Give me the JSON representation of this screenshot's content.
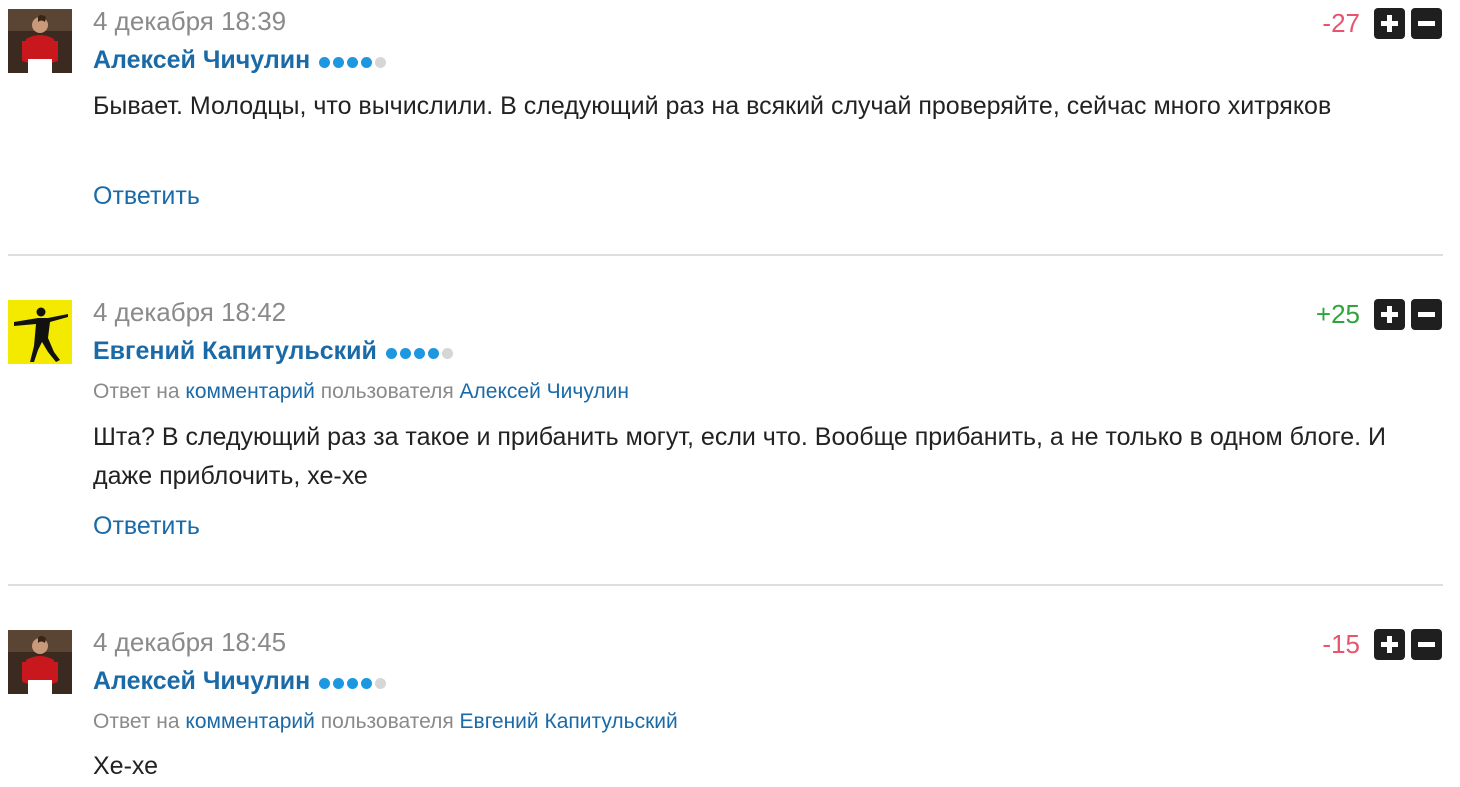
{
  "comments": [
    {
      "timestamp": "4 декабря 18:39",
      "author": "Алексей Чичулин",
      "rank_filled": 4,
      "rank_total": 5,
      "reply_prefix": "",
      "reply_link": "",
      "reply_middle": "",
      "reply_user": "",
      "text": "Бывает. Молодцы, что вычислили. В следующий раз на всякий случай проверяйте, сейчас много хитряков",
      "reply_label": "Ответить",
      "score": "-27",
      "score_sign": "negative"
    },
    {
      "timestamp": "4 декабря 18:42",
      "author": "Евгений Капитульский",
      "rank_filled": 4,
      "rank_total": 5,
      "reply_prefix": "Ответ на ",
      "reply_link": "комментарий",
      "reply_middle": " пользователя ",
      "reply_user": "Алексей Чичулин",
      "text": "Шта? В следующий раз за такое и прибанить могут, если что. Вообще прибанить, а не только в одном блоге. И даже приблочить, хе-хе",
      "reply_label": "Ответить",
      "score": "+25",
      "score_sign": "positive"
    },
    {
      "timestamp": "4 декабря 18:45",
      "author": "Алексей Чичулин",
      "rank_filled": 4,
      "rank_total": 5,
      "reply_prefix": "Ответ на ",
      "reply_link": "комментарий",
      "reply_middle": " пользователя ",
      "reply_user": "Евгений Капитульский",
      "text": "Хе-хе",
      "reply_label": "",
      "score": "-15",
      "score_sign": "negative"
    }
  ],
  "icons": {
    "upvote": "plus-icon",
    "downvote": "minus-icon"
  },
  "colors": {
    "link": "#1a6aa8",
    "negative_score": "#e8546e",
    "positive_score": "#2ea43a",
    "rank_dot": "#1d97df"
  }
}
